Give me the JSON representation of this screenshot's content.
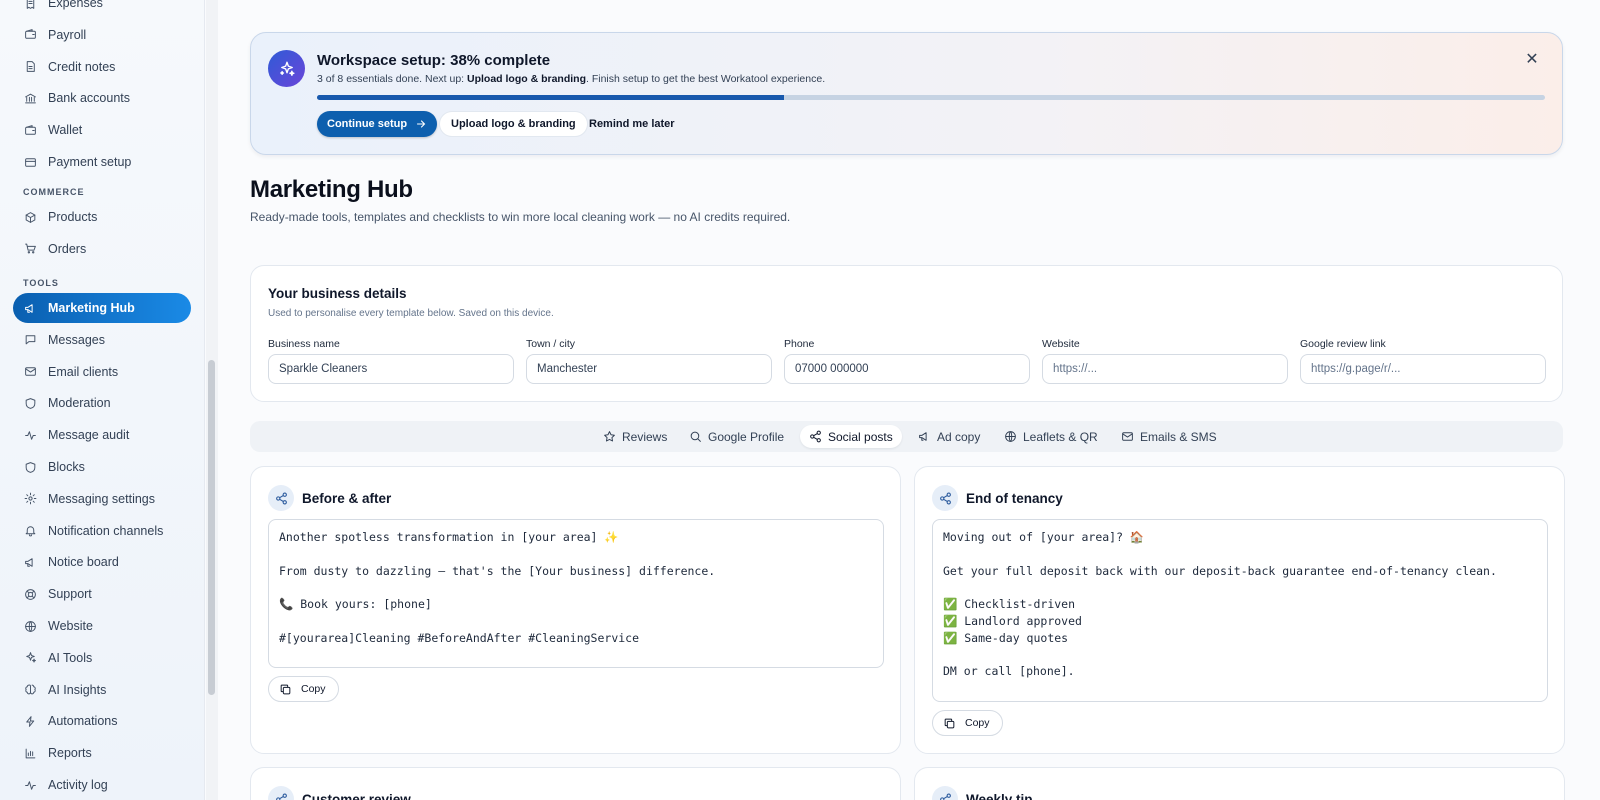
{
  "sidebar": {
    "items_top": [
      {
        "label": "Expenses",
        "icon": "receipt-icon"
      },
      {
        "label": "Payroll",
        "icon": "wallet-icon"
      },
      {
        "label": "Credit notes",
        "icon": "document-icon"
      },
      {
        "label": "Bank accounts",
        "icon": "bank-icon"
      },
      {
        "label": "Wallet",
        "icon": "wallet-icon"
      },
      {
        "label": "Payment setup",
        "icon": "credit-card-icon"
      }
    ],
    "section_commerce": "COMMERCE",
    "items_commerce": [
      {
        "label": "Products",
        "icon": "box-icon"
      },
      {
        "label": "Orders",
        "icon": "cart-icon"
      }
    ],
    "section_tools": "TOOLS",
    "items_tools": [
      {
        "label": "Marketing Hub",
        "icon": "megaphone-icon",
        "active": true
      },
      {
        "label": "Messages",
        "icon": "chat-icon"
      },
      {
        "label": "Email clients",
        "icon": "mail-icon"
      },
      {
        "label": "Moderation",
        "icon": "shield-icon"
      },
      {
        "label": "Message audit",
        "icon": "pulse-icon"
      },
      {
        "label": "Blocks",
        "icon": "shield-icon"
      },
      {
        "label": "Messaging settings",
        "icon": "gear-icon"
      },
      {
        "label": "Notification channels",
        "icon": "bell-icon"
      },
      {
        "label": "Notice board",
        "icon": "megaphone-icon"
      },
      {
        "label": "Support",
        "icon": "lifebuoy-icon"
      },
      {
        "label": "Website",
        "icon": "globe-icon"
      },
      {
        "label": "AI Tools",
        "icon": "sparkles-icon"
      },
      {
        "label": "AI Insights",
        "icon": "brain-icon"
      },
      {
        "label": "Automations",
        "icon": "bolt-icon"
      },
      {
        "label": "Reports",
        "icon": "bar-chart-icon"
      },
      {
        "label": "Activity log",
        "icon": "pulse-icon"
      }
    ]
  },
  "setup": {
    "title": "Workspace setup: 38% complete",
    "sub_prefix": "3 of 8 essentials done. Next up: ",
    "sub_next": "Upload logo & branding",
    "sub_suffix": ". Finish setup to get the best Workatool experience.",
    "progress_pct": 38,
    "continue_label": "Continue setup",
    "upload_label": "Upload logo & branding",
    "remind_label": "Remind me later",
    "close_glyph": "✕"
  },
  "page": {
    "title": "Marketing Hub",
    "subtitle": "Ready-made tools, templates and checklists to win more local cleaning work — no AI credits required."
  },
  "business": {
    "title": "Your business details",
    "subtitle": "Used to personalise every template below. Saved on this device.",
    "fields": [
      {
        "label": "Business name",
        "value": "Sparkle Cleaners",
        "placeholder": ""
      },
      {
        "label": "Town / city",
        "value": "Manchester",
        "placeholder": ""
      },
      {
        "label": "Phone",
        "value": "07000 000000",
        "placeholder": ""
      },
      {
        "label": "Website",
        "value": "",
        "placeholder": "https://..."
      },
      {
        "label": "Google review link",
        "value": "",
        "placeholder": "https://g.page/r/..."
      }
    ]
  },
  "tabs": [
    {
      "label": "Reviews",
      "icon": "star-icon"
    },
    {
      "label": "Google Profile",
      "icon": "search-icon"
    },
    {
      "label": "Social posts",
      "icon": "share-icon",
      "active": true
    },
    {
      "label": "Ad copy",
      "icon": "megaphone-icon"
    },
    {
      "label": "Leaflets & QR",
      "icon": "globe-icon"
    },
    {
      "label": "Emails & SMS",
      "icon": "mail-icon"
    }
  ],
  "cards": [
    {
      "title": "Before & after",
      "text": "Another spotless transformation in [your area] ✨\n\nFrom dusty to dazzling — that's the [Your business] difference.\n\n📞 Book yours: [phone]\n\n#[yourarea]Cleaning #BeforeAndAfter #CleaningService",
      "copy_label": "Copy"
    },
    {
      "title": "End of tenancy",
      "text": "Moving out of [your area]? 🏠\n\nGet your full deposit back with our deposit-back guarantee end-of-tenancy clean.\n\n✅ Checklist-driven\n✅ Landlord approved\n✅ Same-day quotes\n\nDM or call [phone].",
      "copy_label": "Copy"
    },
    {
      "title": "Customer review"
    },
    {
      "title": "Weekly tip"
    }
  ],
  "colors": {
    "accent": "#0d5fae",
    "progress_fill": "#1859ad",
    "active_nav": "#1a8ae6"
  }
}
